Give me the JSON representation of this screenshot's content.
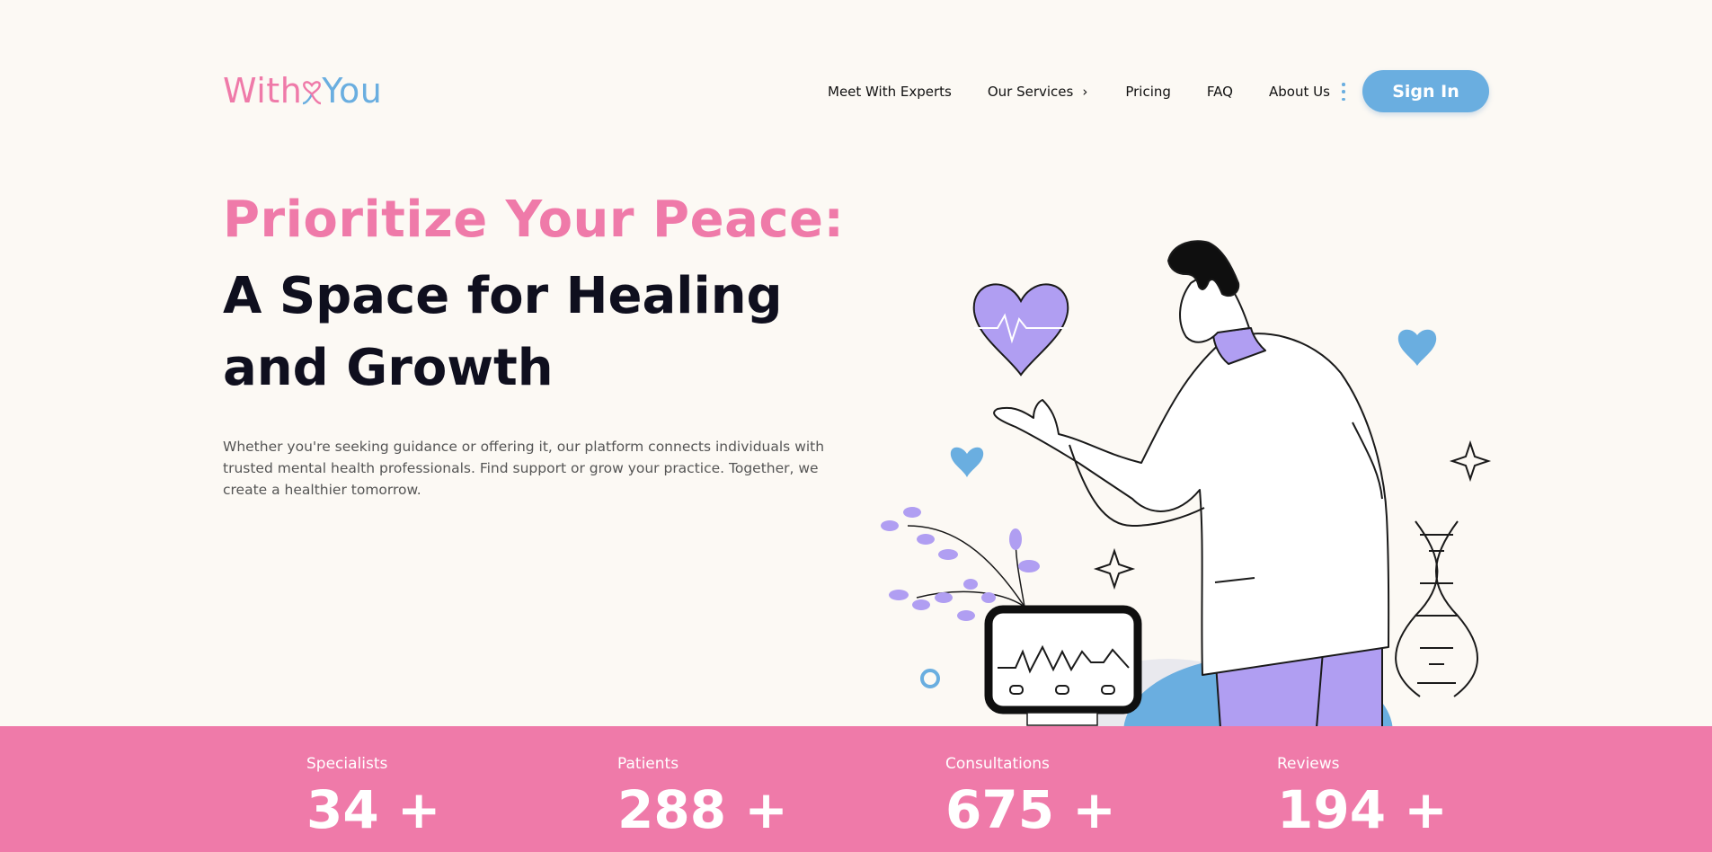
{
  "header": {
    "logo": {
      "part1": "With",
      "part2": "You"
    },
    "nav": [
      {
        "label": "Meet With Experts"
      },
      {
        "label": "Our Services"
      },
      {
        "label": "Pricing"
      },
      {
        "label": "FAQ"
      },
      {
        "label": "About Us"
      }
    ],
    "services_chevron": "›",
    "signin_label": "Sign In"
  },
  "hero": {
    "title_line1": "Prioritize Your Peace:",
    "title_line2": "A Space for Healing and Growth",
    "description": "Whether you're seeking guidance or offering it, our platform connects individuals with trusted mental health professionals. Find support or grow your practice. Together, we create a healthier tomorrow."
  },
  "stats": [
    {
      "label": "Specialists",
      "value": "34 +"
    },
    {
      "label": "Patients",
      "value": "288 +"
    },
    {
      "label": "Consultations",
      "value": "675 +"
    },
    {
      "label": "Reviews",
      "value": "194 +"
    }
  ],
  "colors": {
    "pink": "#ef7aa9",
    "blue": "#6aaee0",
    "purple": "#b09ef2",
    "dark": "#0f0f1e",
    "background": "#fcf9f4"
  },
  "icons": {
    "logo_heart": "heart-stethoscope-icon",
    "kebab": "more-vertical-icon",
    "chevron": "chevron-right-icon"
  }
}
